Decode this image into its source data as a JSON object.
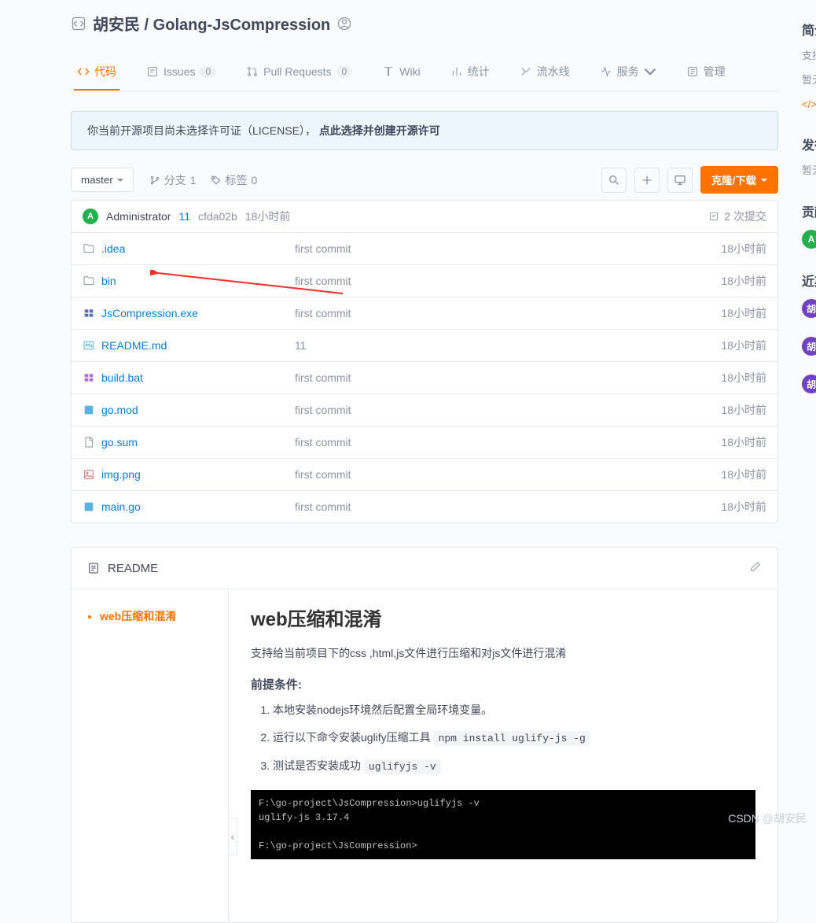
{
  "repo": {
    "owner": "胡安民",
    "name": "Golang-JsCompression"
  },
  "tabs": {
    "code": "代码",
    "issues": "Issues",
    "issues_count": "0",
    "prs": "Pull Requests",
    "prs_count": "0",
    "wiki": "Wiki",
    "stats": "统计",
    "pipeline": "流水线",
    "service": "服务",
    "manage": "管理"
  },
  "license": {
    "text": "你当前开源项目尚未选择许可证（LICENSE），",
    "link": "点此选择并创建开源许可"
  },
  "toolbar": {
    "branch_label": "master",
    "branch": "分支",
    "branch_count": "1",
    "tag": "标签",
    "tag_count": "0",
    "clone": "克隆/下载"
  },
  "commit": {
    "avatar": "A",
    "user": "Administrator",
    "msg": "11",
    "sha": "cfda02b",
    "time": "18小时前",
    "count": "2 次提交"
  },
  "files": [
    {
      "type": "folder",
      "name": ".idea",
      "msg": "first commit",
      "time": "18小时前"
    },
    {
      "type": "folder",
      "name": "bin",
      "msg": "first commit",
      "time": "18小时前"
    },
    {
      "type": "exe",
      "name": "JsCompression.exe",
      "msg": "first commit",
      "time": "18小时前"
    },
    {
      "type": "md",
      "name": "README.md",
      "msg": "11",
      "time": "18小时前"
    },
    {
      "type": "bat",
      "name": "build.bat",
      "msg": "first commit",
      "time": "18小时前"
    },
    {
      "type": "go",
      "name": "go.mod",
      "msg": "first commit",
      "time": "18小时前"
    },
    {
      "type": "txt",
      "name": "go.sum",
      "msg": "first commit",
      "time": "18小时前"
    },
    {
      "type": "img",
      "name": "img.png",
      "msg": "first commit",
      "time": "18小时前"
    },
    {
      "type": "go",
      "name": "main.go",
      "msg": "first commit",
      "time": "18小时前"
    }
  ],
  "readme": {
    "title": "README",
    "toc_item": "web压缩和混淆",
    "h2": "web压缩和混淆",
    "p1": "支持给当前项目下的css ,html,js文件进行压缩和对js文件进行混淆",
    "h3": "前提条件:",
    "li1": "本地安装nodejs环境然后配置全局环境变量。",
    "li2a": "运行以下命令安装uglify压缩工具 ",
    "li2code": "npm install uglify-js -g",
    "li3a": "测试是否安装成功 ",
    "li3code": "uglifyjs -v",
    "terminal": "F:\\go-project\\JsCompression>uglifyjs -v\nuglify-js 3.17.4\n\nF:\\go-project\\JsCompression>"
  },
  "side": {
    "intro_h": "简介",
    "intro_txt": "支持给当前项目下的css ,html,js文件进行压缩和对js文件进行混淆",
    "nolabel": "暂无标签",
    "release_h": "发行版",
    "release_txt": "暂无发行版",
    "contrib_h": "贡献者",
    "contrib_a": "A",
    "recent_h": "近期动态",
    "recent_a": "胡"
  },
  "watermark": "CSDN @胡安民"
}
